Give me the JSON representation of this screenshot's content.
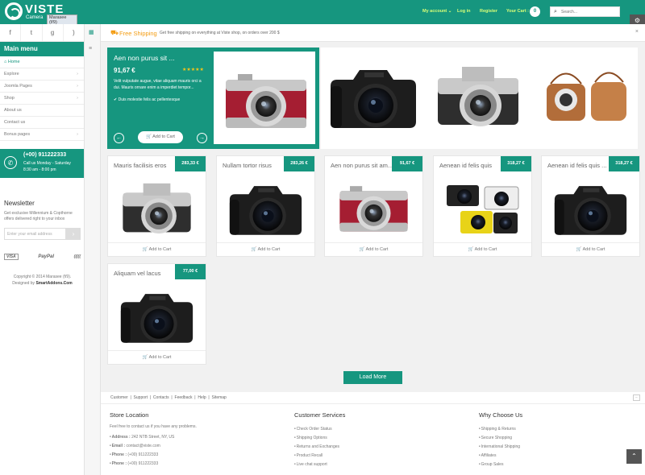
{
  "logo": {
    "name": "VISTE",
    "sub": "Camera",
    "badge": "Marasee (f/9)"
  },
  "header": {
    "my_account": "My account",
    "login": "Log in",
    "register": "Register",
    "your_cart": "Your Cart :",
    "cart_count": "0",
    "search_placeholder": "Search..."
  },
  "sidebar": {
    "title": "Main menu",
    "items": [
      {
        "label": "Home",
        "arrow": ""
      },
      {
        "label": "Explore",
        "arrow": "›"
      },
      {
        "label": "Joomla Pages",
        "arrow": "›"
      },
      {
        "label": "Shop",
        "arrow": "›"
      },
      {
        "label": "About us",
        "arrow": ""
      },
      {
        "label": "Contact us",
        "arrow": ""
      },
      {
        "label": "Bonus pages",
        "arrow": "›"
      }
    ],
    "phone": "(+00) 911222333",
    "call_hours": "Call us Monday - Saturday",
    "call_time": "8:30 am - 8:00 pm",
    "newsletter_title": "Newsletter",
    "newsletter_text": "Get exclusive Millennium & Copthorne offers delivered right to your inbox",
    "email_placeholder": "Enter your email address",
    "payments": [
      "VISA",
      "PayPal",
      "((((("
    ],
    "copyright": "Copyright © 2014 Marasee (f/9).",
    "designed_by": "Designed by",
    "designer": "SmartAddons.Com"
  },
  "shipping_bar": {
    "title": "Free Shipping",
    "text": "Get free shipping on everything at Viste shop, on orders over 200 $"
  },
  "featured": {
    "title": "Aen non purus sit ...",
    "price": "91,67 €",
    "stars": "★★★★★",
    "description": "Velit vulputate augue, vitae aliquam mauris orci a dui. Mauris ornare enim a imperdiet tempor...",
    "check": "Duis molestie felis ac pellentesque",
    "add_to_cart": "Add to Cart"
  },
  "products": [
    {
      "name": "Mauris facilisis eros",
      "price": "283,33 €",
      "cta": "Add to Cart"
    },
    {
      "name": "Nullam tortor risus",
      "price": "283,26 €",
      "cta": "Add to Cart"
    },
    {
      "name": "Aen non purus sit am...",
      "price": "91,67 €",
      "cta": "Add to Cart"
    },
    {
      "name": "Aenean id felis quis",
      "price": "318,27 €",
      "cta": "Add to Cart"
    },
    {
      "name": "Aenean id felis quis ...",
      "price": "318,27 €",
      "cta": "Add to Cart"
    },
    {
      "name": "Aliquam vel lacus",
      "price": "77,00 €",
      "cta": "Add to Cart"
    }
  ],
  "load_more": "Load More",
  "footer": {
    "links": [
      "Customer",
      "Support",
      "Contacts",
      "Feedback",
      "Help",
      "Sitemap"
    ],
    "store_title": "Store Location",
    "store_intro": "Feel free to contact us if you have any problems.",
    "store_lines": [
      {
        "k": "Address :",
        "v": "242 NTB Street, NY, US"
      },
      {
        "k": "Email :",
        "v": "contact@viste.com"
      },
      {
        "k": "Phone :",
        "v": "(+00) 911222333"
      },
      {
        "k": "Phone :",
        "v": "(+00) 911222333"
      }
    ],
    "service_title": "Customer Services",
    "service_items": [
      "Check Order Status",
      "Shipping Options",
      "Returns and Exchanges",
      "Product Recall",
      "Live chat support"
    ],
    "why_title": "Why Choose Us",
    "why_items": [
      "Shipping & Returns",
      "Secure Shopping",
      "International Shipping",
      "Affiliates",
      "Group Sales"
    ]
  },
  "colors": {
    "brand": "#16967f",
    "accent": "#f39c12"
  }
}
